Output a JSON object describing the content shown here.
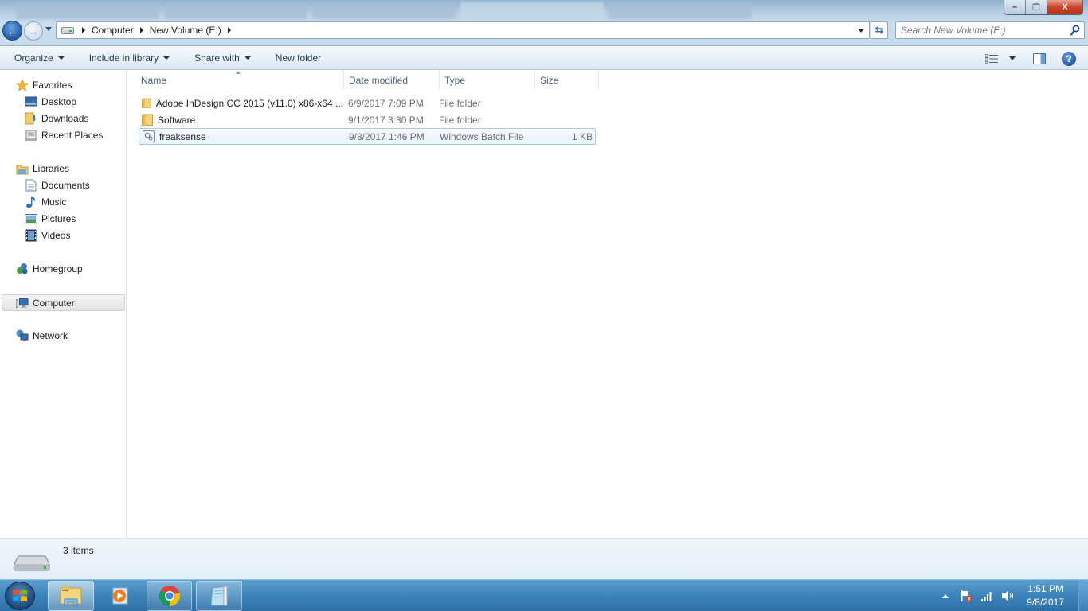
{
  "window": {
    "title": "New Volume (E:)",
    "controls": {
      "minimize": "–",
      "restore": "❐",
      "close": "X"
    }
  },
  "nav": {
    "back_icon": "back-arrow-icon",
    "forward_icon": "forward-arrow-icon",
    "back_glyph": "←",
    "forward_glyph": "→"
  },
  "address": {
    "crumbs": [
      "Computer",
      "New Volume (E:)"
    ],
    "refresh_glyph": "⇆"
  },
  "search": {
    "placeholder": "Search New Volume (E:)"
  },
  "toolbar": {
    "organize": "Organize",
    "include_in_library": "Include in library",
    "share_with": "Share with",
    "new_folder": "New folder",
    "help_glyph": "?"
  },
  "navpane": {
    "favorites": {
      "label": "Favorites",
      "items": [
        "Desktop",
        "Downloads",
        "Recent Places"
      ]
    },
    "libraries": {
      "label": "Libraries",
      "items": [
        "Documents",
        "Music",
        "Pictures",
        "Videos"
      ]
    },
    "homegroup": "Homegroup",
    "computer": "Computer",
    "network": "Network"
  },
  "columns": [
    "Name",
    "Date modified",
    "Type",
    "Size"
  ],
  "files": [
    {
      "name": "Adobe InDesign CC 2015 (v11.0) x86-x64 ...",
      "date": "6/9/2017 7:09 PM",
      "type": "File folder",
      "size": "",
      "icon": "folder-icon"
    },
    {
      "name": "Software",
      "date": "9/1/2017 3:30 PM",
      "type": "File folder",
      "size": "",
      "icon": "folder-icon"
    },
    {
      "name": "freaksense",
      "date": "9/8/2017 1:46 PM",
      "type": "Windows Batch File",
      "size": "1 KB",
      "icon": "batch-file-icon",
      "selected": true
    }
  ],
  "details": {
    "count": "3 items"
  },
  "taskbar": {
    "apps": [
      "Windows Explorer",
      "Windows Media Player",
      "Google Chrome",
      "Notepad"
    ],
    "clock": {
      "time": "1:51 PM",
      "date": "9/8/2017"
    }
  }
}
